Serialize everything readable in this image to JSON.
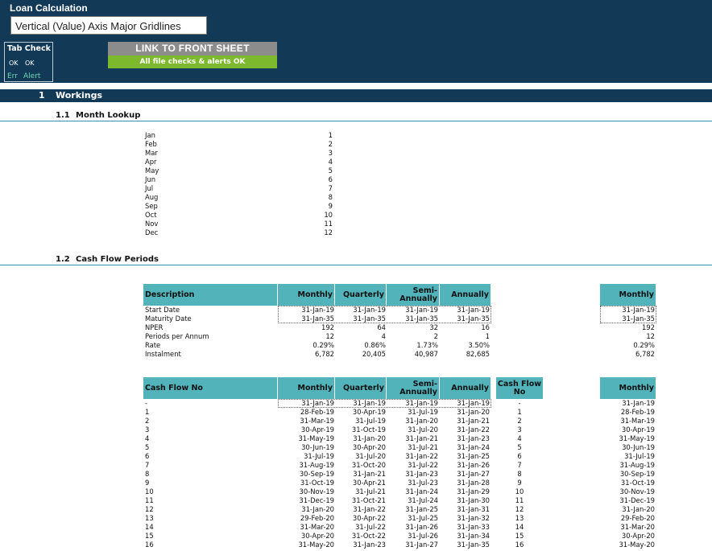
{
  "header": {
    "title": "Loan Calculation",
    "tooltip": "Vertical (Value) Axis Major Gridlines",
    "tab_check": {
      "label": "Tab Check",
      "ok1": "OK",
      "ok2": "OK",
      "err": "Err",
      "alert": "Alert"
    },
    "link_button": "LINK TO FRONT SHEET",
    "checks_status": "All file checks & alerts OK"
  },
  "section": {
    "number": "1",
    "title": "Workings"
  },
  "month_lookup": {
    "number": "1.1",
    "title": "Month Lookup",
    "rows": [
      {
        "m": "Jan",
        "n": "1"
      },
      {
        "m": "Feb",
        "n": "2"
      },
      {
        "m": "Mar",
        "n": "3"
      },
      {
        "m": "Apr",
        "n": "4"
      },
      {
        "m": "May",
        "n": "5"
      },
      {
        "m": "Jun",
        "n": "6"
      },
      {
        "m": "Jul",
        "n": "7"
      },
      {
        "m": "Aug",
        "n": "8"
      },
      {
        "m": "Sep",
        "n": "9"
      },
      {
        "m": "Oct",
        "n": "10"
      },
      {
        "m": "Nov",
        "n": "11"
      },
      {
        "m": "Dec",
        "n": "12"
      }
    ]
  },
  "cash_flow_periods": {
    "number": "1.2",
    "title": "Cash Flow Periods",
    "table1": {
      "headers": [
        "Description",
        "Monthly",
        "Quarterly",
        "Semi-Annually",
        "Annually"
      ],
      "side_header": "Monthly",
      "rows": [
        {
          "label": "Start Date",
          "vals": [
            "31-Jan-19",
            "31-Jan-19",
            "31-Jan-19",
            "31-Jan-19"
          ],
          "side": "31-Jan-19"
        },
        {
          "label": "Maturity Date",
          "vals": [
            "31-Jan-35",
            "31-Jan-35",
            "31-Jan-35",
            "31-Jan-35"
          ],
          "side": "31-Jan-35"
        },
        {
          "label": "NPER",
          "vals": [
            "192",
            "64",
            "32",
            "16"
          ],
          "side": "192"
        },
        {
          "label": "Periods per Annum",
          "vals": [
            "12",
            "4",
            "2",
            "1"
          ],
          "side": "12"
        },
        {
          "label": "Rate",
          "vals": [
            "0.29%",
            "0.86%",
            "1.73%",
            "3.50%"
          ],
          "side": "0.29%"
        },
        {
          "label": "Instalment",
          "vals": [
            "6,782",
            "20,405",
            "40,987",
            "82,685"
          ],
          "side": "6,782"
        }
      ]
    },
    "table2": {
      "headers": [
        "Cash Flow No",
        "Monthly",
        "Quarterly",
        "Semi-Annually",
        "Annually",
        "Cash Flow No"
      ],
      "side_header": "Monthly",
      "rows": [
        {
          "no": "-",
          "m": "31-Jan-19",
          "q": "31-Jan-19",
          "s": "31-Jan-19",
          "a": "31-Jan-19",
          "no2": "-",
          "side": "31-Jan-19"
        },
        {
          "no": "1",
          "m": "28-Feb-19",
          "q": "30-Apr-19",
          "s": "31-Jul-19",
          "a": "31-Jan-20",
          "no2": "1",
          "side": "28-Feb-19"
        },
        {
          "no": "2",
          "m": "31-Mar-19",
          "q": "31-Jul-19",
          "s": "31-Jan-20",
          "a": "31-Jan-21",
          "no2": "2",
          "side": "31-Mar-19"
        },
        {
          "no": "3",
          "m": "30-Apr-19",
          "q": "31-Oct-19",
          "s": "31-Jul-20",
          "a": "31-Jan-22",
          "no2": "3",
          "side": "30-Apr-19"
        },
        {
          "no": "4",
          "m": "31-May-19",
          "q": "31-Jan-20",
          "s": "31-Jan-21",
          "a": "31-Jan-23",
          "no2": "4",
          "side": "31-May-19"
        },
        {
          "no": "5",
          "m": "30-Jun-19",
          "q": "30-Apr-20",
          "s": "31-Jul-21",
          "a": "31-Jan-24",
          "no2": "5",
          "side": "30-Jun-19"
        },
        {
          "no": "6",
          "m": "31-Jul-19",
          "q": "31-Jul-20",
          "s": "31-Jan-22",
          "a": "31-Jan-25",
          "no2": "6",
          "side": "31-Jul-19"
        },
        {
          "no": "7",
          "m": "31-Aug-19",
          "q": "31-Oct-20",
          "s": "31-Jul-22",
          "a": "31-Jan-26",
          "no2": "7",
          "side": "31-Aug-19"
        },
        {
          "no": "8",
          "m": "30-Sep-19",
          "q": "31-Jan-21",
          "s": "31-Jan-23",
          "a": "31-Jan-27",
          "no2": "8",
          "side": "30-Sep-19"
        },
        {
          "no": "9",
          "m": "31-Oct-19",
          "q": "30-Apr-21",
          "s": "31-Jul-23",
          "a": "31-Jan-28",
          "no2": "9",
          "side": "31-Oct-19"
        },
        {
          "no": "10",
          "m": "30-Nov-19",
          "q": "31-Jul-21",
          "s": "31-Jan-24",
          "a": "31-Jan-29",
          "no2": "10",
          "side": "30-Nov-19"
        },
        {
          "no": "11",
          "m": "31-Dec-19",
          "q": "31-Oct-21",
          "s": "31-Jul-24",
          "a": "31-Jan-30",
          "no2": "11",
          "side": "31-Dec-19"
        },
        {
          "no": "12",
          "m": "31-Jan-20",
          "q": "31-Jan-22",
          "s": "31-Jan-25",
          "a": "31-Jan-31",
          "no2": "12",
          "side": "31-Jan-20"
        },
        {
          "no": "13",
          "m": "29-Feb-20",
          "q": "30-Apr-22",
          "s": "31-Jul-25",
          "a": "31-Jan-32",
          "no2": "13",
          "side": "29-Feb-20"
        },
        {
          "no": "14",
          "m": "31-Mar-20",
          "q": "31-Jul-22",
          "s": "31-Jan-26",
          "a": "31-Jan-33",
          "no2": "14",
          "side": "31-Mar-20"
        },
        {
          "no": "15",
          "m": "30-Apr-20",
          "q": "31-Oct-22",
          "s": "31-Jul-26",
          "a": "31-Jan-34",
          "no2": "15",
          "side": "30-Apr-20"
        },
        {
          "no": "16",
          "m": "31-May-20",
          "q": "31-Jan-23",
          "s": "31-Jan-27",
          "a": "31-Jan-35",
          "no2": "16",
          "side": "31-May-20"
        }
      ]
    }
  }
}
